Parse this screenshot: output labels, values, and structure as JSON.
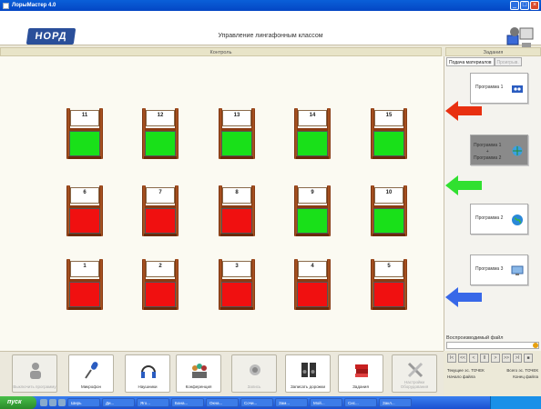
{
  "window": {
    "title": "ЛорыМастер 4.0"
  },
  "header": {
    "logo": "НОРД",
    "heading": "Управление лингафонным классом"
  },
  "panels": {
    "left_title": "Контроль",
    "right_title": "Задания"
  },
  "booths": [
    {
      "num": "11",
      "status": "green"
    },
    {
      "num": "12",
      "status": "green"
    },
    {
      "num": "13",
      "status": "green"
    },
    {
      "num": "14",
      "status": "green"
    },
    {
      "num": "15",
      "status": "green"
    },
    {
      "num": "6",
      "status": "red"
    },
    {
      "num": "7",
      "status": "red"
    },
    {
      "num": "8",
      "status": "red"
    },
    {
      "num": "9",
      "status": "green"
    },
    {
      "num": "10",
      "status": "green"
    },
    {
      "num": "1",
      "status": "red"
    },
    {
      "num": "2",
      "status": "red"
    },
    {
      "num": "3",
      "status": "red"
    },
    {
      "num": "4",
      "status": "red"
    },
    {
      "num": "5",
      "status": "red"
    }
  ],
  "sidebar": {
    "tabs": [
      {
        "label": "Подача материалов",
        "active": true
      },
      {
        "label": "Проигрыв.",
        "active": false
      }
    ],
    "programs": [
      {
        "label": "Программа 1"
      },
      {
        "label_line1": "Программа 1",
        "label_line2": "+",
        "label_line3": "Программа 2"
      },
      {
        "label": "Программа 2"
      },
      {
        "label": "Программа 3"
      }
    ],
    "input_label": "Воспроизводимый файл",
    "status": {
      "row1_left": "Текущее эс. ТОЧЕК",
      "row1_right": "Всего эс. ТОЧЕК",
      "row2_left": "Начало файла",
      "row2_right": "Конец файла"
    }
  },
  "transport": [
    "I<",
    "<<",
    "<",
    "II",
    ">",
    ">>",
    ">I",
    "■"
  ],
  "colors": {
    "booth_green": "#19e019",
    "booth_red": "#f01010",
    "arrow_red": "#e83010",
    "arrow_green": "#30e030",
    "arrow_blue": "#3868e8"
  },
  "toolbar": [
    {
      "label": "Выключить программу",
      "icon": "person-icon",
      "disabled": true
    },
    {
      "label": "Микрофон",
      "icon": "microphone-icon",
      "disabled": false
    },
    {
      "label": "Наушники",
      "icon": "headphones-icon",
      "disabled": false
    },
    {
      "label": "Конференция",
      "icon": "group-icon",
      "disabled": false
    },
    {
      "label": "Запись",
      "icon": "record-icon",
      "disabled": true
    },
    {
      "label": "Записать дорожки",
      "icon": "speakers-icon",
      "disabled": false
    },
    {
      "label": "Задания",
      "icon": "books-icon",
      "disabled": false
    },
    {
      "label": "Настройки Оборудования",
      "icon": "tools-icon",
      "disabled": true
    }
  ],
  "taskbar": {
    "start": "пуск",
    "tasks": [
      "Ширь",
      "Ди...",
      "Яго...",
      "Бана...",
      "Окна...",
      "Сочи...",
      "Зам...",
      "Мой...",
      "Сис...",
      "Закл..."
    ]
  }
}
